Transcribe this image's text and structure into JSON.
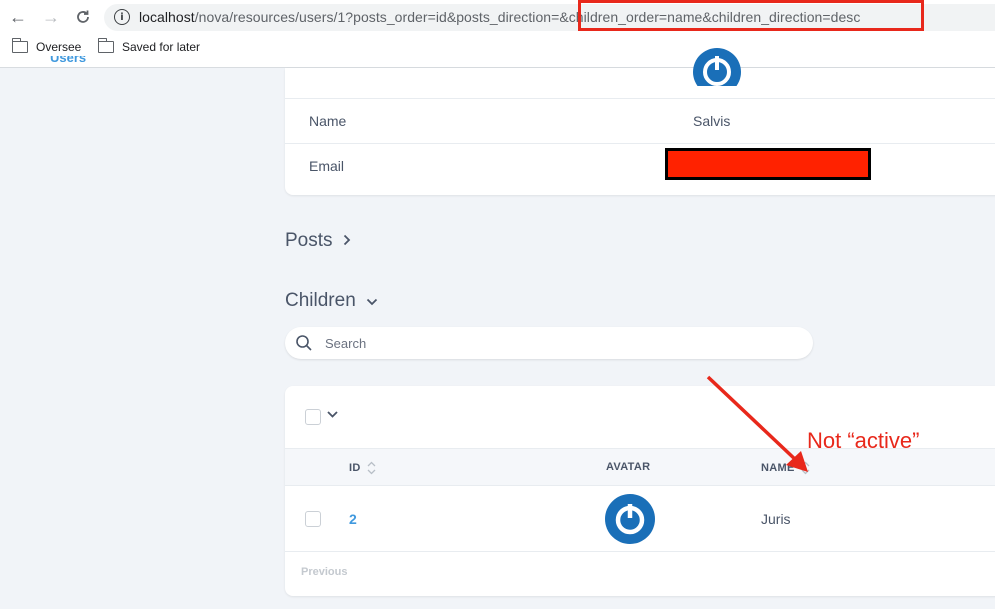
{
  "browser": {
    "url_host": "localhost",
    "url_rest_before": "/nova/resources/users/1?posts_order=id&posts_direction=",
    "url_highlighted": "&children_order=name&children_direction=desc",
    "info_icon": "info-icon",
    "bookmarks": [
      {
        "label": "Oversee",
        "icon": "folder-icon"
      },
      {
        "label": "Saved for later",
        "icon": "folder-icon"
      }
    ]
  },
  "sidebar": {
    "active_item": "Users"
  },
  "detail": {
    "fields": [
      {
        "label": "Name",
        "value": "Salvis"
      },
      {
        "label": "Email",
        "value": ""
      }
    ]
  },
  "sections": {
    "posts_title": "Posts",
    "children_title": "Children"
  },
  "search": {
    "placeholder": "Search"
  },
  "table": {
    "columns": [
      {
        "label": "ID",
        "sortable": true
      },
      {
        "label": "AVATAR",
        "sortable": false
      },
      {
        "label": "NAME",
        "sortable": true
      }
    ],
    "rows": [
      {
        "id": "2",
        "name": "Juris"
      }
    ],
    "pagination_previous": "Previous"
  },
  "annotation": {
    "text": "Not “active”",
    "color": "#e8281b"
  },
  "colors": {
    "accent": "#4099de",
    "avatar_blue": "#1a6fb8",
    "highlight_red": "#e8281b"
  }
}
